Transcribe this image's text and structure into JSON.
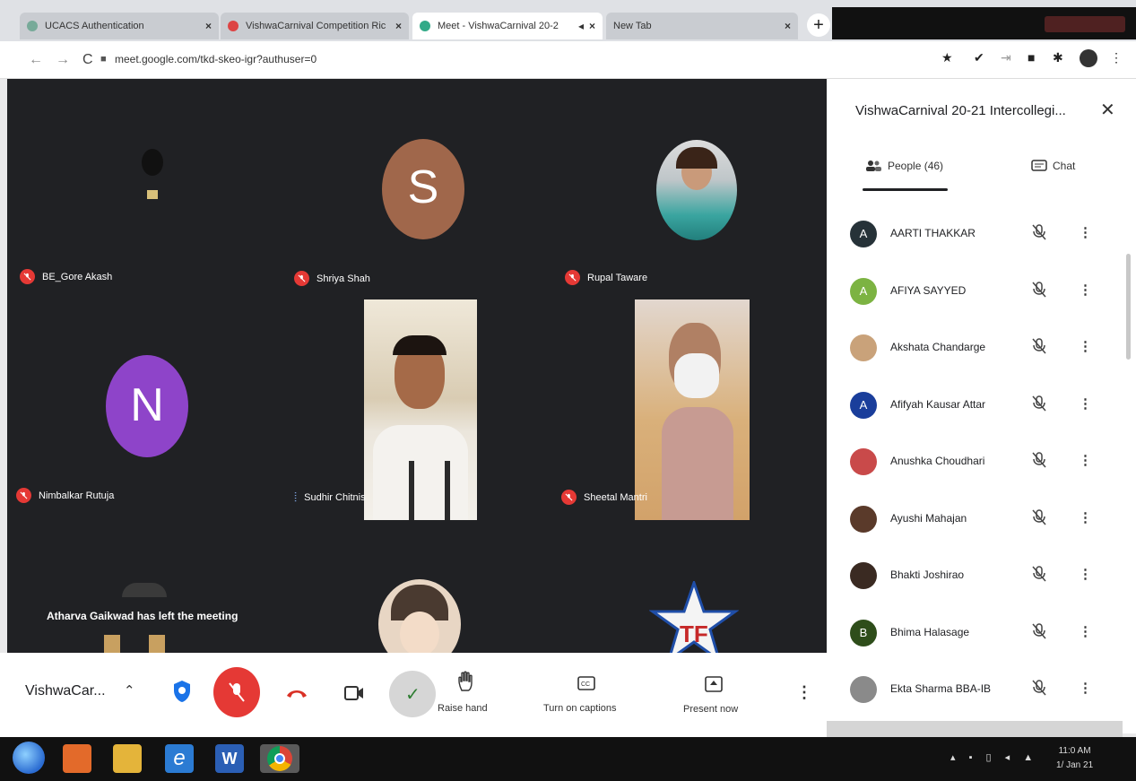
{
  "browser": {
    "tabs": [
      {
        "title": "UCACS Authentication",
        "favicon": "#7a9",
        "active": false
      },
      {
        "title": "VishwaCarnival Competition Ric",
        "favicon": "#d44",
        "active": false
      },
      {
        "title": "Meet - VishwaCarnival 20-2",
        "favicon": "#3a8",
        "active": true
      },
      {
        "title": "New Tab",
        "favicon": "#bbb",
        "active": false
      }
    ],
    "url": "meet.google.com/tkd-skeo-igr?authuser=0"
  },
  "grid": {
    "tiles": [
      {
        "name": "BE_Gore Akash",
        "state": "muted",
        "kind": "video-dark"
      },
      {
        "name": "Shriya Shah",
        "state": "muted",
        "kind": "letter",
        "letter": "S",
        "color": "#a0674b"
      },
      {
        "name": "Rupal Taware",
        "state": "muted",
        "kind": "photo"
      },
      {
        "name": "Nimbalkar Rutuja",
        "state": "muted",
        "kind": "letter",
        "letter": "N",
        "color": "#8e44c9"
      },
      {
        "name": "Sudhir Chitnis",
        "state": "speaking",
        "kind": "video"
      },
      {
        "name": "Sheetal Mantri",
        "state": "muted",
        "kind": "video"
      }
    ],
    "toast": "Atharva Gaikwad has left the meeting"
  },
  "panel": {
    "title": "VishwaCarnival 20-21 Intercollegi...",
    "people_tab": "People (46)",
    "chat_tab": "Chat",
    "participants": [
      {
        "name": "AARTI THAKKAR",
        "initial": "A",
        "color": "#263238"
      },
      {
        "name": "AFIYA SAYYED",
        "initial": "A",
        "color": "#7cb342"
      },
      {
        "name": "Akshata Chandarge",
        "initial": "",
        "color": "#c9a27a"
      },
      {
        "name": "Afifyah Kausar Attar",
        "initial": "A",
        "color": "#1a3e9b"
      },
      {
        "name": "Anushka Choudhari",
        "initial": "",
        "color": "#c94a4a"
      },
      {
        "name": "Ayushi Mahajan",
        "initial": "",
        "color": "#5a3a2a"
      },
      {
        "name": "Bhakti Joshirao",
        "initial": "",
        "color": "#3a2a22"
      },
      {
        "name": "Bhima Halasage",
        "initial": "B",
        "color": "#2e4d1a"
      },
      {
        "name": "Ekta Sharma BBA-IB",
        "initial": "",
        "color": "#8a8a8a"
      }
    ]
  },
  "bottombar": {
    "meeting_title": "VishwaCar...",
    "raise_hand": "Raise hand",
    "captions": "Turn on captions",
    "present": "Present now"
  },
  "taskbar": {
    "time": "11:0 AM",
    "date": "1/ Jan 21"
  },
  "colors": {
    "mic_off_red": "#e53935",
    "meet_dark": "#202124",
    "accent": "#1a73e8"
  }
}
